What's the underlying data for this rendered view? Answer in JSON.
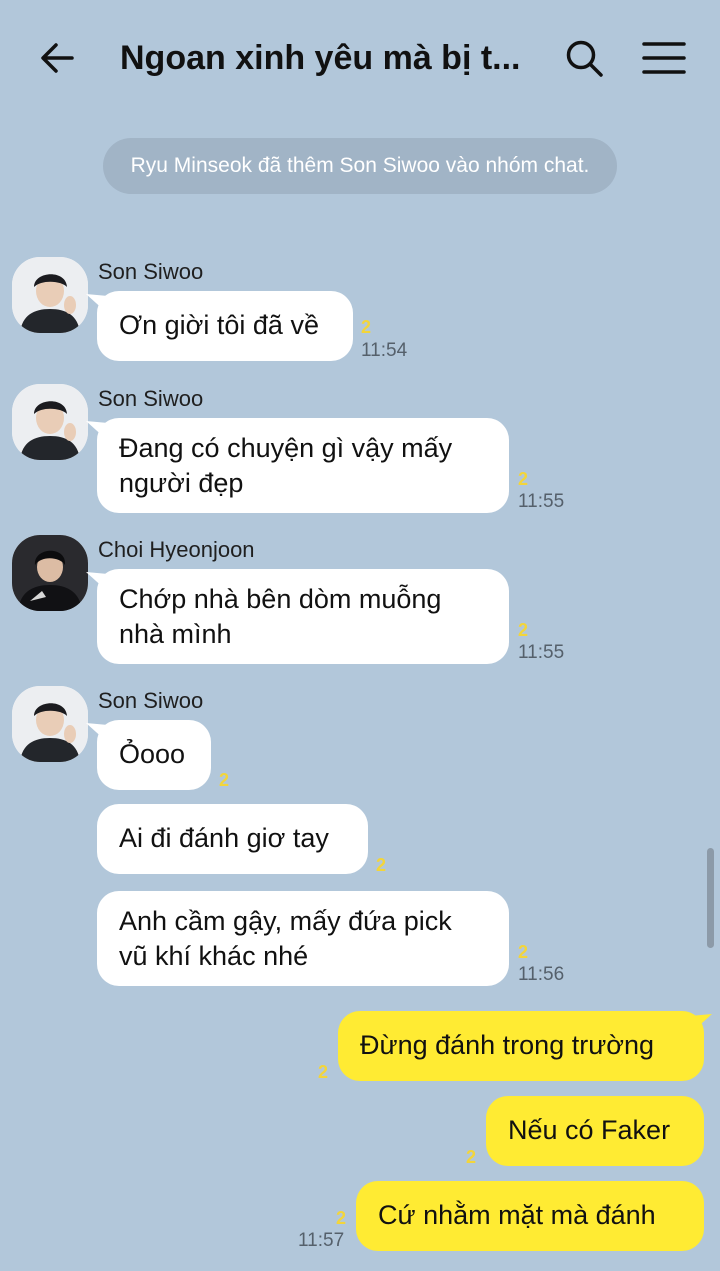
{
  "header": {
    "title": "Ngoan xinh yêu mà bị t...",
    "icons": [
      "back-arrow-icon",
      "search-icon",
      "menu-icon"
    ]
  },
  "system_notice": "Ryu Minseok đã thêm Son Siwoo vào nhóm chat.",
  "messages": [
    {
      "sender": "Son Siwoo",
      "text": "Ơn giời tôi đã về",
      "unread": "2",
      "time": "11:54"
    },
    {
      "sender": "Son Siwoo",
      "lines": [
        "Đang có chuyện gì vậy mấy",
        "người đẹp"
      ],
      "unread": "2",
      "time": "11:55"
    },
    {
      "sender": "Choi Hyeonjoon",
      "lines": [
        "Chớp nhà bên dòm muỗng",
        "nhà mình"
      ],
      "unread": "2",
      "time": "11:55"
    },
    {
      "sender": "Son Siwoo",
      "text": "Ỏooo",
      "unread": "2"
    },
    {
      "text": "Ai đi đánh giơ tay",
      "unread": "2"
    },
    {
      "lines": [
        "Anh cầm gậy, mấy đứa pick",
        "vũ khí khác nhé"
      ],
      "unread": "2",
      "time": "11:56"
    }
  ],
  "outgoing": [
    {
      "text": "Đừng đánh trong trường",
      "unread": "2"
    },
    {
      "text": "Nếu có Faker",
      "unread": "2"
    },
    {
      "text": "Cứ nhằm mặt mà đánh",
      "unread": "2",
      "time": "11:57"
    }
  ],
  "colors": {
    "background": "#b2c7da",
    "incoming_bubble": "#ffffff",
    "outgoing_bubble": "#ffeb33",
    "unread_count": "#f3d53a",
    "notice_bg": "#a1b4c6"
  }
}
